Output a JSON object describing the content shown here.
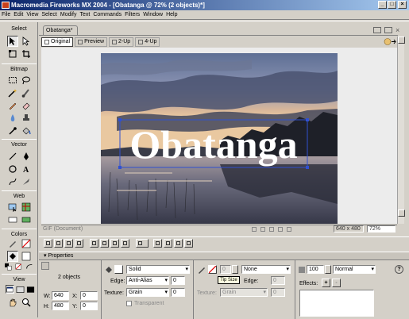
{
  "window": {
    "title": "Macromedia Fireworks MX 2004 - [Obatanga @ 72% (2 objects)*]",
    "min": "_",
    "max": "□",
    "close": "×"
  },
  "menu": [
    "File",
    "Edit",
    "View",
    "Select",
    "Modify",
    "Text",
    "Commands",
    "Filters",
    "Window",
    "Help"
  ],
  "tools": {
    "sections": [
      "Select",
      "Bitmap",
      "Vector",
      "Web",
      "Colors",
      "View"
    ]
  },
  "document": {
    "tab_label": "Obatanga*",
    "view_tabs": [
      "Original",
      "Preview",
      "2-Up",
      "4-Up"
    ],
    "canvas_text": "Obatanga",
    "status_left": "GIF (Document)",
    "size_readout": "640 x 480",
    "zoom": "72%"
  },
  "properties": {
    "header": "Properties",
    "selection_summary": "2 objects",
    "w_label": "W:",
    "w_value": "640",
    "h_label": "H:",
    "h_value": "480",
    "x_label": "X:",
    "x_value": "0",
    "y_label": "Y:",
    "y_value": "0",
    "fill_type": "Solid",
    "edge_label": "Edge:",
    "edge_value": "Anti-Alias",
    "edge_amount": "0",
    "texture_label": "Texture:",
    "texture_value": "Grain",
    "texture_amount": "0",
    "transparent_label": "Transparent",
    "stroke_size": "0",
    "stroke_type": "None",
    "tooltip": "Tip Size",
    "stroke_edge_label": "Edge:",
    "stroke_edge_amount": "0",
    "stroke_texture_label": "Texture:",
    "stroke_texture_value": "Grain",
    "stroke_texture_amount": "0",
    "opacity": "100",
    "blend_mode": "Normal",
    "effects_label": "Effects:",
    "effects_add": "+",
    "effects_remove": "-",
    "help": "?"
  },
  "colors": {
    "title_start": "#0a246a",
    "title_end": "#a6caf0",
    "canvas_text": "#ffffff"
  }
}
